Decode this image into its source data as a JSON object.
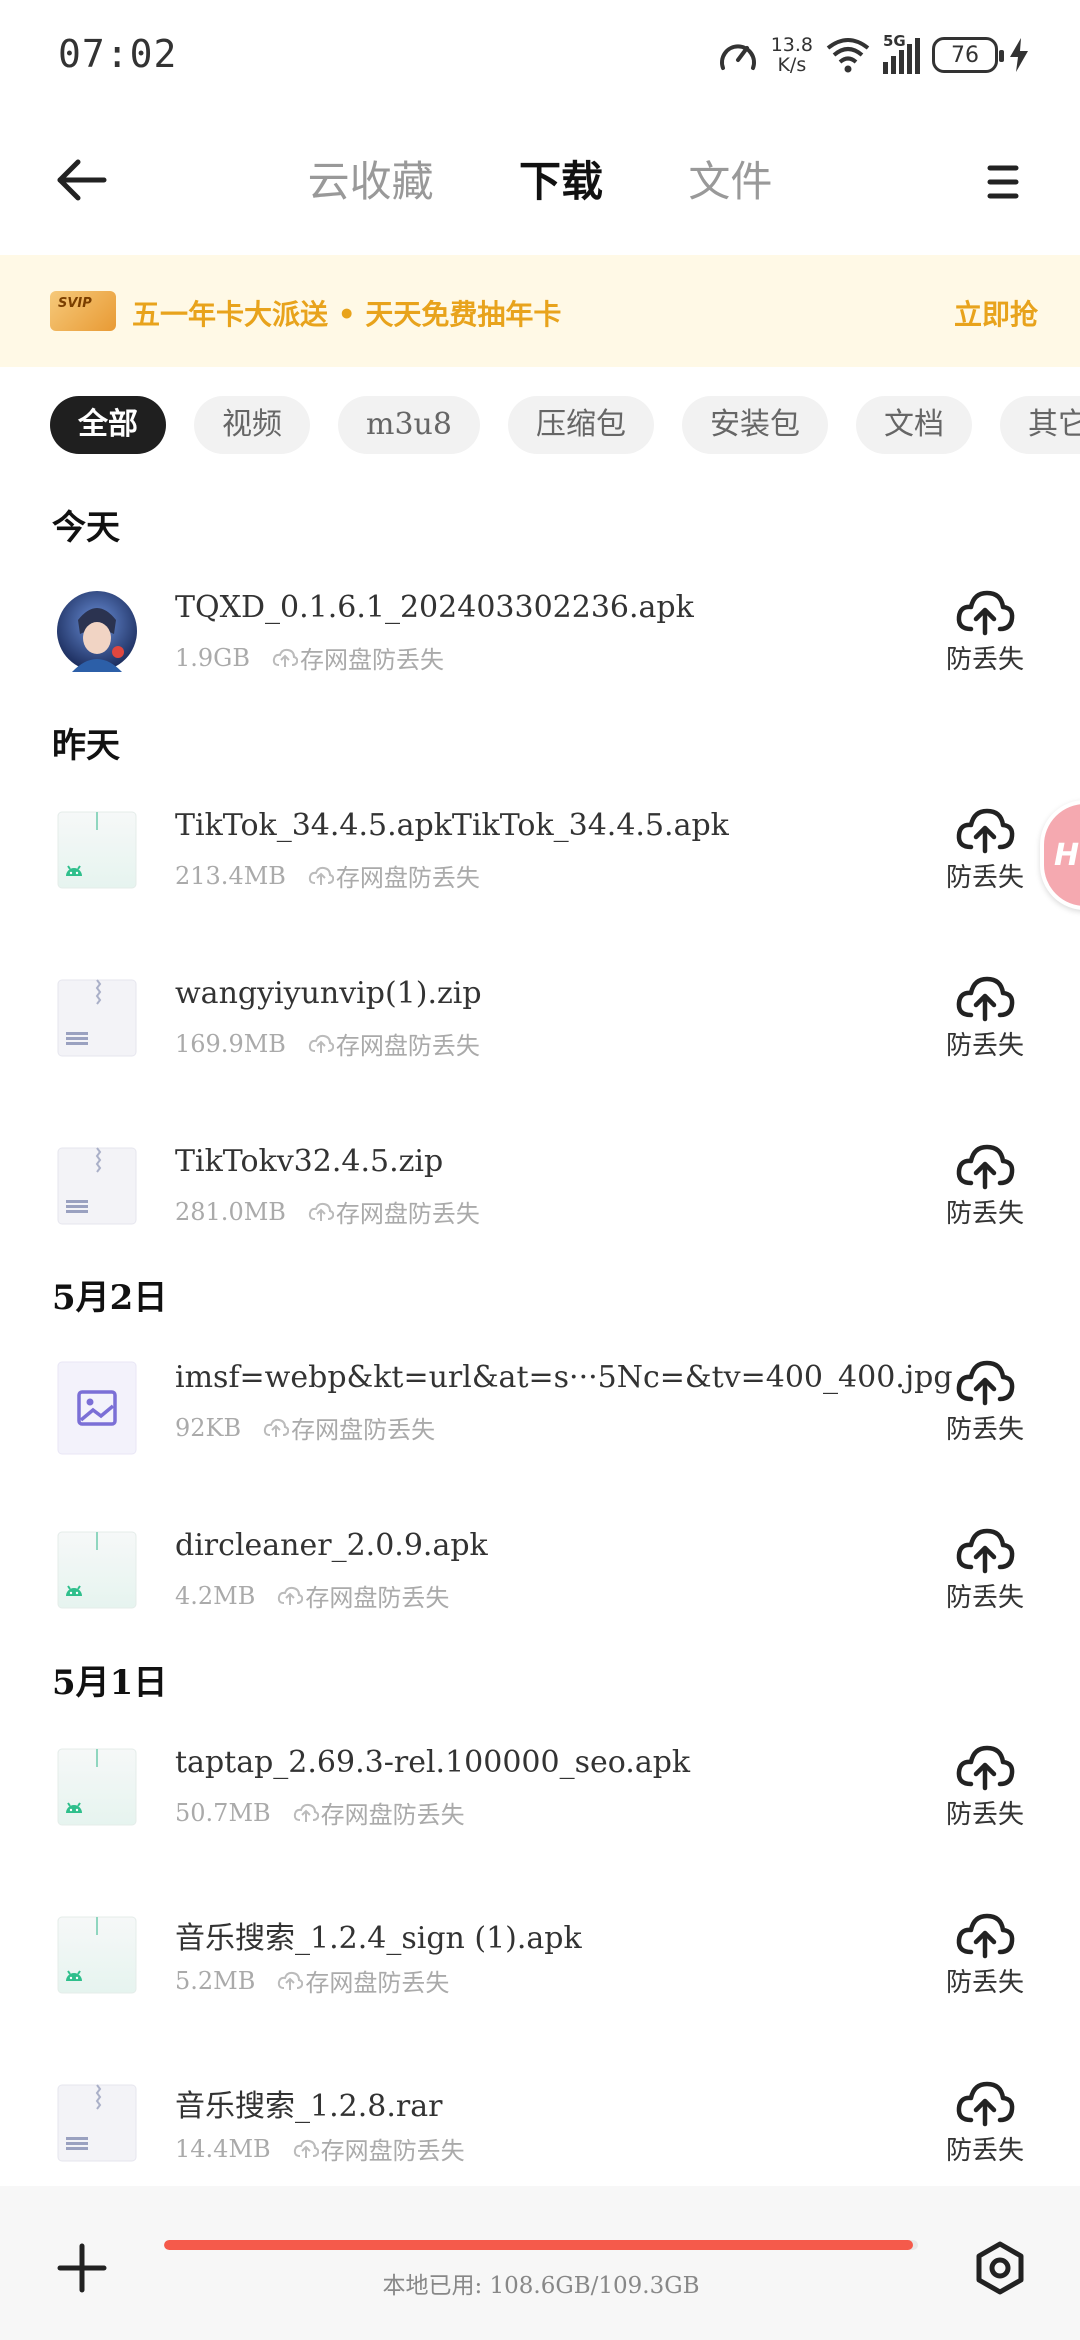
{
  "status_bar": {
    "time": "07:02",
    "net_speed_value": "13.8",
    "net_speed_unit": "K/s",
    "network": "5G",
    "battery": "76"
  },
  "header": {
    "tabs": [
      {
        "label": "云收藏",
        "active": false
      },
      {
        "label": "下载",
        "active": true
      },
      {
        "label": "文件",
        "active": false
      }
    ]
  },
  "banner": {
    "badge": "SVIP",
    "text": "五一年卡大派送 • 天天免费抽年卡",
    "cta": "立即抢",
    "color": "#e8a31c"
  },
  "filters": [
    "全部",
    "视频",
    "m3u8",
    "压缩包",
    "安装包",
    "文档",
    "其它"
  ],
  "save_hint": "存网盘防丢失",
  "upload_label": "防丢失",
  "sections": [
    {
      "title": "今天",
      "files": [
        {
          "name": "TQXD_0.1.6.1_202403302236.apk",
          "size": "1.9GB",
          "icon": "game-avatar-icon"
        }
      ]
    },
    {
      "title": "昨天",
      "files": [
        {
          "name": "TikTok_34.4.5.apkTikTok_34.4.5.apk",
          "size": "213.4MB",
          "icon": "apk-file-icon"
        },
        {
          "name": "wangyiyunvip(1).zip",
          "size": "169.9MB",
          "icon": "zip-file-icon"
        },
        {
          "name": "TikTokv32.4.5.zip",
          "size": "281.0MB",
          "icon": "zip-file-icon"
        }
      ]
    },
    {
      "title": "5月2日",
      "files": [
        {
          "name": "imsf=webp&kt=url&at=s···5Nc=&tv=400_400.jpg",
          "size": "92KB",
          "icon": "image-file-icon"
        },
        {
          "name": "dircleaner_2.0.9.apk",
          "size": "4.2MB",
          "icon": "apk-file-icon"
        }
      ]
    },
    {
      "title": "5月1日",
      "files": [
        {
          "name": "taptap_2.69.3-rel.100000_seo.apk",
          "size": "50.7MB",
          "icon": "apk-file-icon"
        },
        {
          "name": "音乐搜索_1.2.4_sign (1).apk",
          "size": "5.2MB",
          "icon": "apk-file-icon"
        },
        {
          "name": "音乐搜索_1.2.8.rar",
          "size": "14.4MB",
          "icon": "zip-file-icon"
        }
      ]
    }
  ],
  "floating_badge": "HU",
  "bottom": {
    "storage_text": "本地已用: 108.6GB/109.3GB",
    "used_fraction": 0.994,
    "bar_color": "#f55a4b"
  }
}
